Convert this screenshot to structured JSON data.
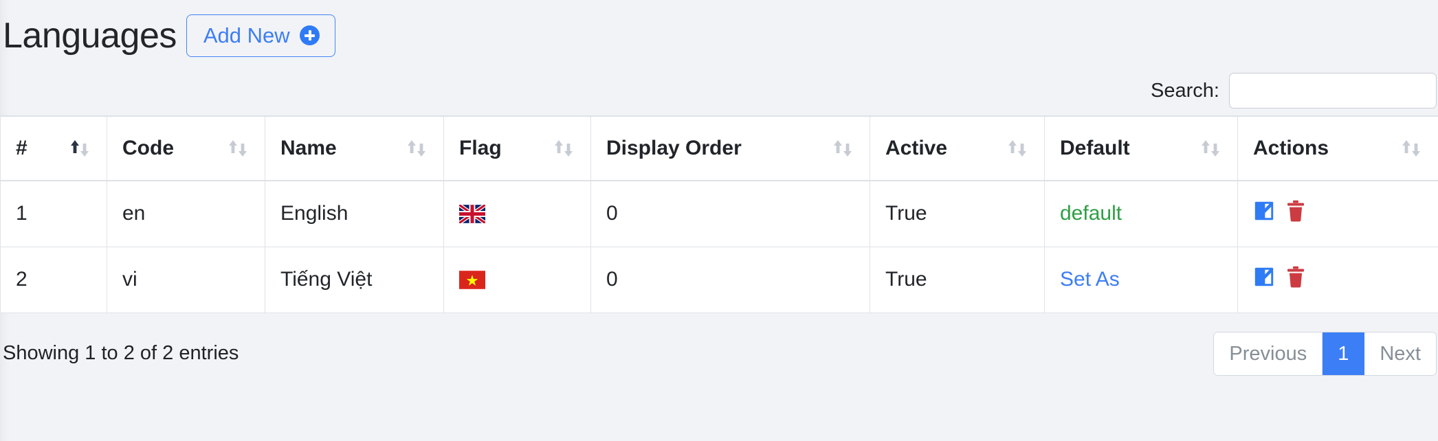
{
  "header": {
    "title": "Languages",
    "add_new_label": "Add New",
    "add_new_icon": "plus-circle-icon"
  },
  "search": {
    "label": "Search:",
    "value": "",
    "placeholder": ""
  },
  "table": {
    "columns": [
      {
        "key": "num",
        "label": "#",
        "sort": "asc"
      },
      {
        "key": "code",
        "label": "Code",
        "sort": "none"
      },
      {
        "key": "name",
        "label": "Name",
        "sort": "none"
      },
      {
        "key": "flag",
        "label": "Flag",
        "sort": "none"
      },
      {
        "key": "order",
        "label": "Display Order",
        "sort": "none"
      },
      {
        "key": "active",
        "label": "Active",
        "sort": "none"
      },
      {
        "key": "def",
        "label": "Default",
        "sort": "none"
      },
      {
        "key": "act",
        "label": "Actions",
        "sort": "none"
      }
    ],
    "rows": [
      {
        "num": "1",
        "code": "en",
        "name": "English",
        "flag_glyph": "🇬🇧",
        "flag_name": "united-kingdom-flag-icon",
        "order": "0",
        "active": "True",
        "default_label": "default",
        "default_state": "is-default",
        "edit_icon": "edit-pencil-icon",
        "delete_icon": "trash-icon"
      },
      {
        "num": "2",
        "code": "vi",
        "name": "Tiếng Việt",
        "flag_glyph": "🇻🇳",
        "flag_name": "vietnam-flag-icon",
        "order": "0",
        "active": "True",
        "default_label": "Set As",
        "default_state": "set-as",
        "edit_icon": "edit-pencil-icon",
        "delete_icon": "trash-icon"
      }
    ]
  },
  "footer": {
    "showing_text": "Showing 1 to 2 of 2 entries",
    "pagination": {
      "previous_label": "Previous",
      "pages": [
        "1"
      ],
      "active_page": "1",
      "next_label": "Next"
    }
  },
  "colors": {
    "page_background": "#f2f3f7",
    "accent_blue": "#3d7ef4",
    "active_page_blue": "#3b7ef6",
    "default_green": "#2f9e44",
    "delete_red": "#cc3b41",
    "border": "#dee2e6",
    "sort_inactive": "#c7ccd4",
    "sort_active": "#2b3445"
  }
}
